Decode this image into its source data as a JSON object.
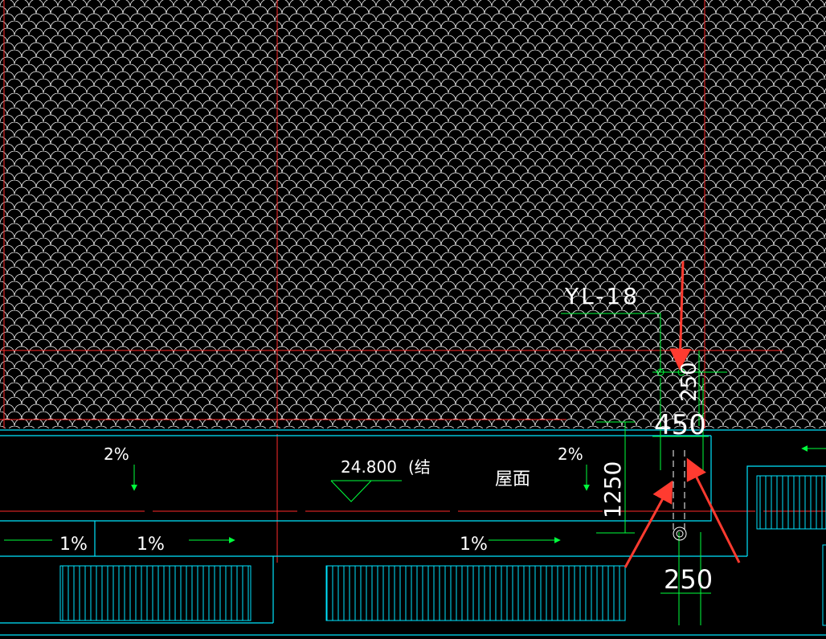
{
  "drawing": {
    "beam_tag": "YL-18",
    "elevation": "24.800",
    "elevation_suffix": "(结",
    "roof_label": "屋面",
    "slope_2pct_left": "2%",
    "slope_2pct_right": "2%",
    "slope_1pct_a": "1%",
    "slope_1pct_b": "1%",
    "slope_1pct_c": "1%",
    "dim_450": "450",
    "dim_1250": "1250",
    "dim_250": "250",
    "dim_partial_vertical": "250"
  },
  "colors": {
    "background": "#000000",
    "tile_pattern": "#ffffff",
    "axis_lines": "#ff2a2a",
    "structure_lines": "#00e5ff",
    "dimension_lines": "#00ff3c",
    "annotation_arrows": "#ff3b30"
  }
}
